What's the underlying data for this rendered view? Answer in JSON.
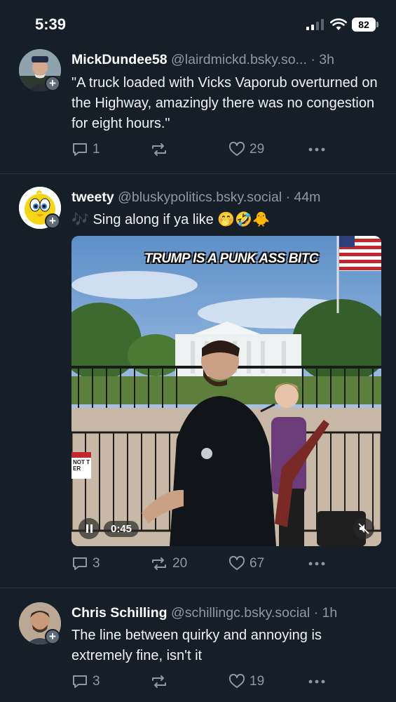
{
  "status_bar": {
    "time": "5:39",
    "battery": "82"
  },
  "posts": [
    {
      "author": "MickDundee58",
      "handle": "@lairdmickd.bsky.so...",
      "time": "· 3h",
      "text": "\"A truck loaded with Vicks Vaporub overturned on the Highway, amazingly there was no congestion for eight hours.\"",
      "replies": "1",
      "reposts": "",
      "likes": "29"
    },
    {
      "author": "tweety",
      "handle": "@bluskypolitics.bsky.social",
      "time": "· 44m",
      "text_emoji_lead": "🎶",
      "text": "Sing along if ya like",
      "text_emoji_trail": "🤭🤣🐥",
      "video": {
        "caption": "TRUMP IS A PUNK ASS BITC",
        "sign_text": "NOT TER",
        "elapsed": "0:45"
      },
      "replies": "3",
      "reposts": "20",
      "likes": "67"
    },
    {
      "author": "Chris Schilling",
      "handle": "@schillingc.bsky.social",
      "time": "· 1h",
      "text": "The line between quirky and annoying is extremely fine, isn't it",
      "replies": "3",
      "reposts": "",
      "likes": "19"
    }
  ],
  "colors": {
    "background": "#161e27",
    "muted": "#8d99a6",
    "divider": "#2a333e"
  },
  "icons": [
    "reply-icon",
    "repost-icon",
    "like-icon",
    "more-icon",
    "pause-icon",
    "mute-icon",
    "wifi-icon",
    "signal-icon"
  ]
}
